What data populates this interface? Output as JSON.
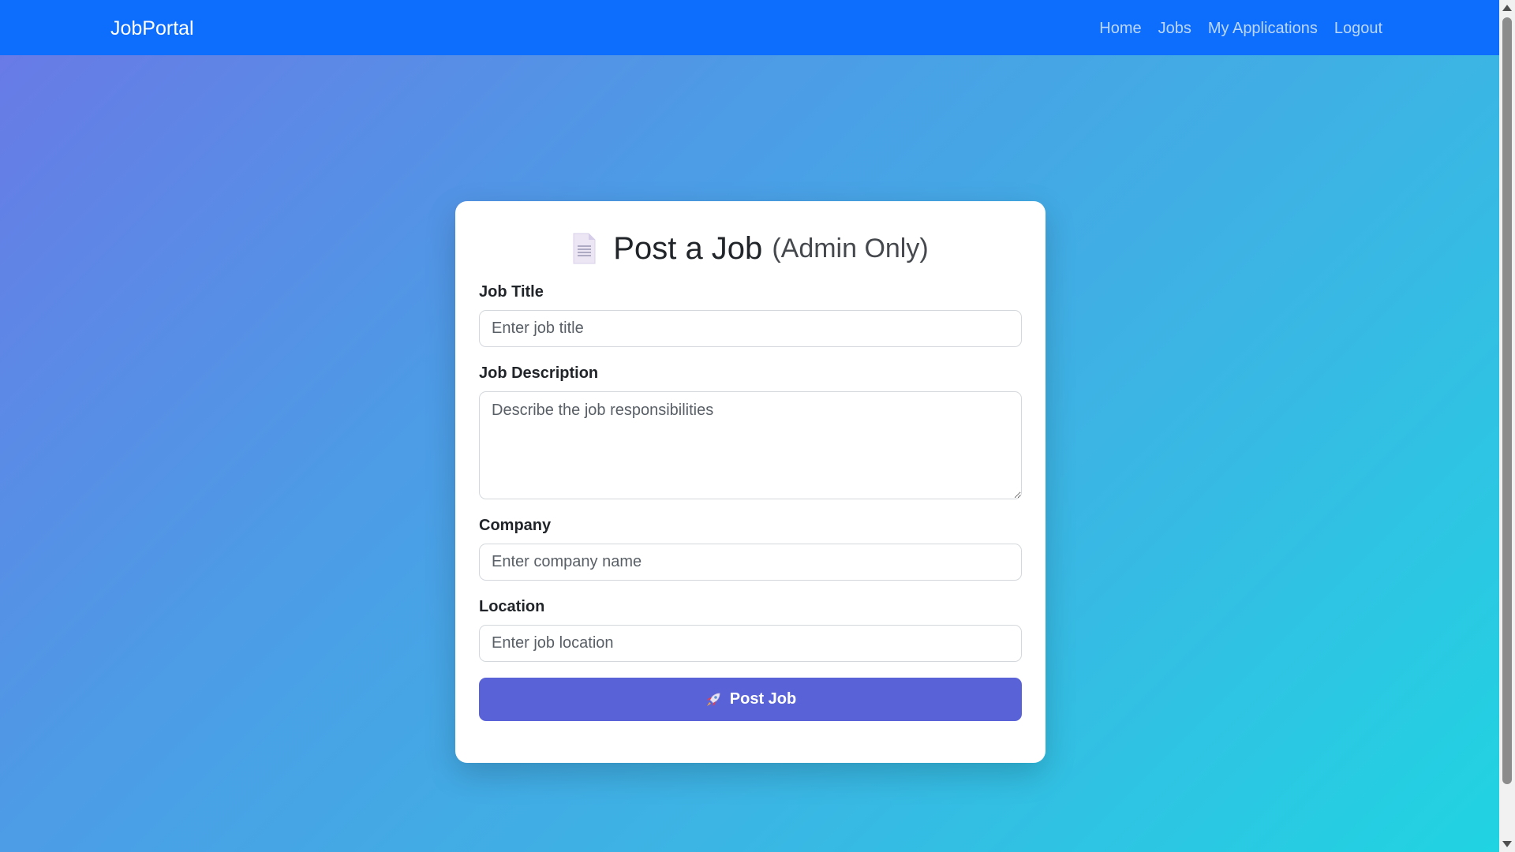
{
  "navbar": {
    "brand": "JobPortal",
    "links": [
      "Home",
      "Jobs",
      "My Applications",
      "Logout"
    ]
  },
  "form": {
    "title": "Post a Job",
    "title_suffix": "(Admin Only)",
    "title_icon": "document-icon",
    "fields": {
      "job_title": {
        "label": "Job Title",
        "placeholder": "Enter job title",
        "value": ""
      },
      "job_description": {
        "label": "Job Description",
        "placeholder": "Describe the job responsibilities",
        "value": ""
      },
      "company": {
        "label": "Company",
        "placeholder": "Enter company name",
        "value": ""
      },
      "location": {
        "label": "Location",
        "placeholder": "Enter job location",
        "value": ""
      }
    },
    "submit_label": "Post Job",
    "submit_icon": "rocket-icon"
  },
  "colors": {
    "navbar": "#0d6efd",
    "button": "#5a62d8",
    "gradient_start": "#6a78e6",
    "gradient_end": "#20d4e2"
  }
}
